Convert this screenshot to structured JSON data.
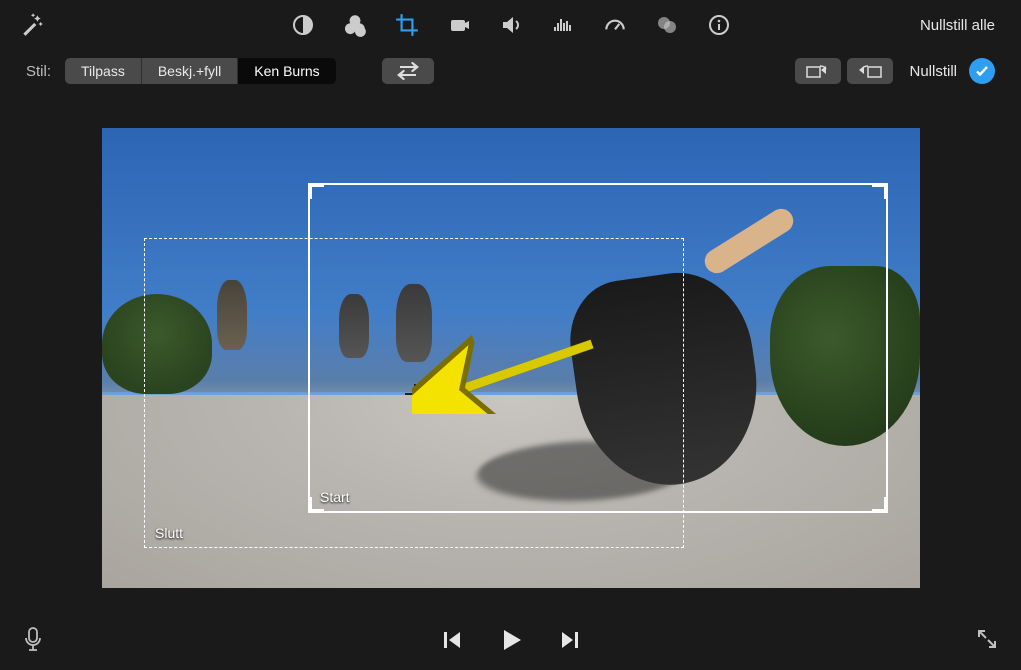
{
  "toolbar": {
    "reset_all_label": "Nullstill alle"
  },
  "crop": {
    "style_label": "Stil:",
    "styles": {
      "fit": "Tilpass",
      "crop_fill": "Beskj.+fyll",
      "ken_burns": "Ken Burns"
    },
    "reset_label": "Nullstill"
  },
  "ken_burns": {
    "start_label": "Start",
    "end_label": "Slutt"
  }
}
